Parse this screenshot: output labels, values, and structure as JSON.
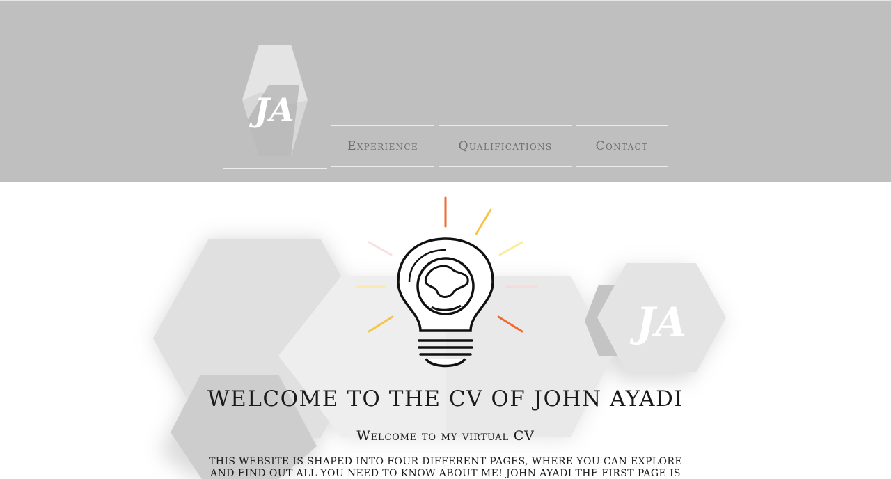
{
  "header": {
    "logo_text": "JA",
    "nav": [
      {
        "label": "Experience"
      },
      {
        "label": "Qualifications"
      },
      {
        "label": "Contact"
      }
    ]
  },
  "hero": {
    "badge_text": "JA",
    "title": "WELCOME TO THE CV OF JOHN AYADI",
    "subtitle": "Welcome to my virtual CV",
    "intro": "This website is shaped into four different pages, where you can explore and find out all you need to know about me! John Ayadi The first page is the"
  },
  "colors": {
    "header_bg": "#bfbfbf",
    "nav_text": "#707070",
    "ray_orange": "#f26a2e",
    "ray_yellow": "#f7c34a"
  },
  "icons": [
    "ja-logo-icon",
    "lightbulb-globe-icon"
  ]
}
